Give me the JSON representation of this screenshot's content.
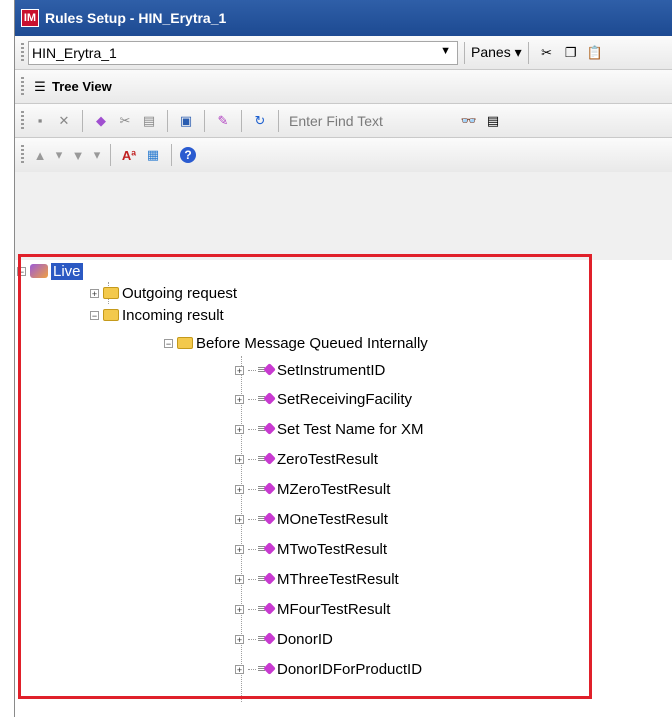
{
  "window": {
    "title": "Rules Setup - HIN_Erytra_1",
    "app_icon": "IM"
  },
  "toolbar1": {
    "selected_setup": "HIN_Erytra_1",
    "panes_label": "Panes"
  },
  "toolbar2": {
    "tree_view_label": "Tree View"
  },
  "toolbar3": {
    "find_placeholder": "Enter Find Text"
  },
  "tree": {
    "root": "Live",
    "outgoing": "Outgoing request",
    "incoming": "Incoming result",
    "before_queued": "Before Message Queued Internally",
    "rules": [
      "SetInstrumentID",
      "SetReceivingFacility",
      "Set Test Name for XM",
      "ZeroTestResult",
      "MZeroTestResult",
      "MOneTestResult",
      "MTwoTestResult",
      "MThreeTestResult",
      "MFourTestResult",
      "DonorID",
      "DonorIDForProductID"
    ]
  },
  "colors": {
    "highlight": "#e0202a",
    "selection": "#2b59c3",
    "titlebar": "#1d4a92"
  }
}
